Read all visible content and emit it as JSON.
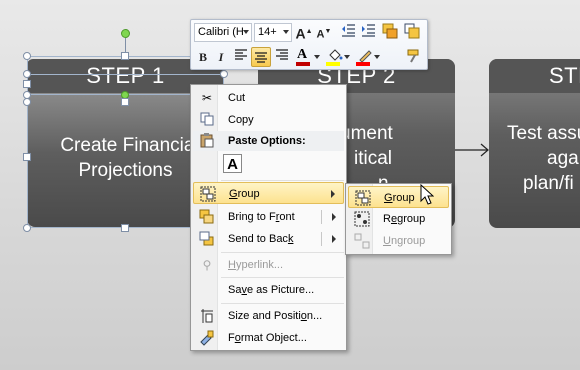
{
  "steps": [
    {
      "title": "STEP 1",
      "text_line1": "Create Financial",
      "text_line2": "Projections"
    },
    {
      "title": "STEP 2",
      "text_line1": "ument",
      "text_line2": "itical",
      "text_line3": "n"
    },
    {
      "title": "STE",
      "text_line1": "Test assu",
      "text_line2": "aga",
      "text_line3": "plan/fi"
    }
  ],
  "mini_toolbar": {
    "font_name": "Calibri (H",
    "font_size": "14+",
    "grow_font_icon": "grow-font-icon",
    "shrink_font_icon": "shrink-font-icon",
    "bold": "B",
    "italic": "I",
    "font_color_letter": "A",
    "font_color": "#c00000",
    "highlight_color": "#ffff00",
    "line_color": "#ff0000"
  },
  "context_menu": {
    "items": [
      {
        "label": "Cut",
        "icon": "scissors-icon",
        "disabled": false
      },
      {
        "label": "Copy",
        "icon": "copy-icon",
        "disabled": false
      },
      {
        "label": "Paste Options:",
        "icon": "paste-icon",
        "disabled": false
      },
      {
        "label": "A",
        "icon": "paste-keep-text-icon",
        "disabled": false
      },
      {
        "label": "Group",
        "icon": "group-icon",
        "disabled": false,
        "submenu": true,
        "highlighted": true
      },
      {
        "label": "Bring to Front",
        "icon": "bring-to-front-icon",
        "disabled": false,
        "submenu": true
      },
      {
        "label": "Send to Back",
        "icon": "send-to-back-icon",
        "disabled": false,
        "submenu": true
      },
      {
        "label": "Hyperlink...",
        "icon": "hyperlink-icon",
        "disabled": true
      },
      {
        "label": "Save as Picture...",
        "icon": "",
        "disabled": false
      },
      {
        "label": "Size and Position...",
        "icon": "size-position-icon",
        "disabled": false
      },
      {
        "label": "Format Object...",
        "icon": "format-object-icon",
        "disabled": false
      }
    ]
  },
  "submenu": {
    "items": [
      {
        "label": "Group",
        "icon": "group-icon",
        "highlighted": true,
        "disabled": false
      },
      {
        "label": "Regroup",
        "icon": "regroup-icon",
        "disabled": false
      },
      {
        "label": "Ungroup",
        "icon": "ungroup-icon",
        "disabled": true
      }
    ]
  },
  "colors": {
    "step_header": "#555555",
    "menu_highlight": "#fde28f",
    "connector": "#222222"
  }
}
